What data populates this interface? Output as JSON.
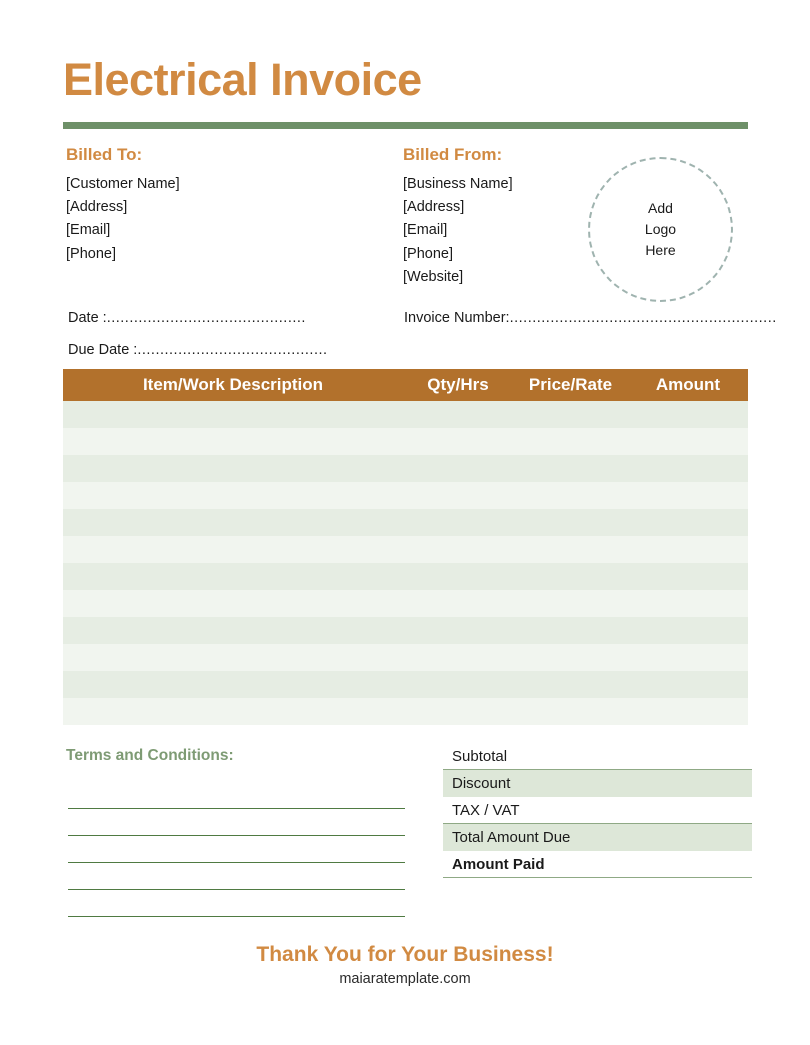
{
  "document": {
    "title": "Electrical Invoice"
  },
  "billed_to": {
    "heading": "Billed To:",
    "lines": [
      "[Customer Name]",
      "[Address]",
      "[Email]",
      "[Phone]"
    ]
  },
  "billed_from": {
    "heading": "Billed From:",
    "lines": [
      "[Business Name]",
      "[Address]",
      "[Email]",
      "[Phone]",
      "[Website]"
    ]
  },
  "logo_placeholder": {
    "line1": "Add",
    "line2": "Logo",
    "line3": "Here"
  },
  "fields": {
    "date_label": "Date :",
    "date_value": "",
    "date_dots": "............................................",
    "due_date_label": "Due Date  :",
    "due_date_value": "",
    "due_date_dots": "..........................................",
    "invoice_number_label": "Invoice Number:",
    "invoice_number_value": "",
    "invoice_number_dots": "..........................................................."
  },
  "items_table": {
    "columns": [
      "Item/Work Description",
      "Qty/Hrs",
      "Price/Rate",
      "Amount"
    ],
    "empty_row_count": 12,
    "rows": []
  },
  "terms": {
    "heading": "Terms and Conditions:",
    "line_count": 5,
    "lines": [
      "",
      "",
      "",
      "",
      ""
    ]
  },
  "totals": {
    "rows": [
      {
        "label": "Subtotal",
        "value": "",
        "style": "plain"
      },
      {
        "label": "Discount",
        "value": "",
        "style": "shaded"
      },
      {
        "label": "TAX / VAT",
        "value": "",
        "style": "plain"
      },
      {
        "label": "Total Amount Due",
        "value": "",
        "style": "shaded"
      },
      {
        "label": "Amount Paid",
        "value": "",
        "style": "bold"
      }
    ]
  },
  "footer": {
    "thanks": "Thank You for Your Business!",
    "website": "maiaratemplate.com"
  },
  "colors": {
    "title_orange": "#D18A42",
    "divider_green": "#6E9068",
    "table_header_brown": "#B2712C",
    "row_stripe_dark": "#E6EDE3",
    "row_stripe_light": "#F1F5EF",
    "terms_heading_green": "#7E9B74",
    "terms_line_green": "#4F7A42",
    "totals_shaded_green": "#DDE7D8",
    "logo_border_gray": "#9FB3AF"
  }
}
